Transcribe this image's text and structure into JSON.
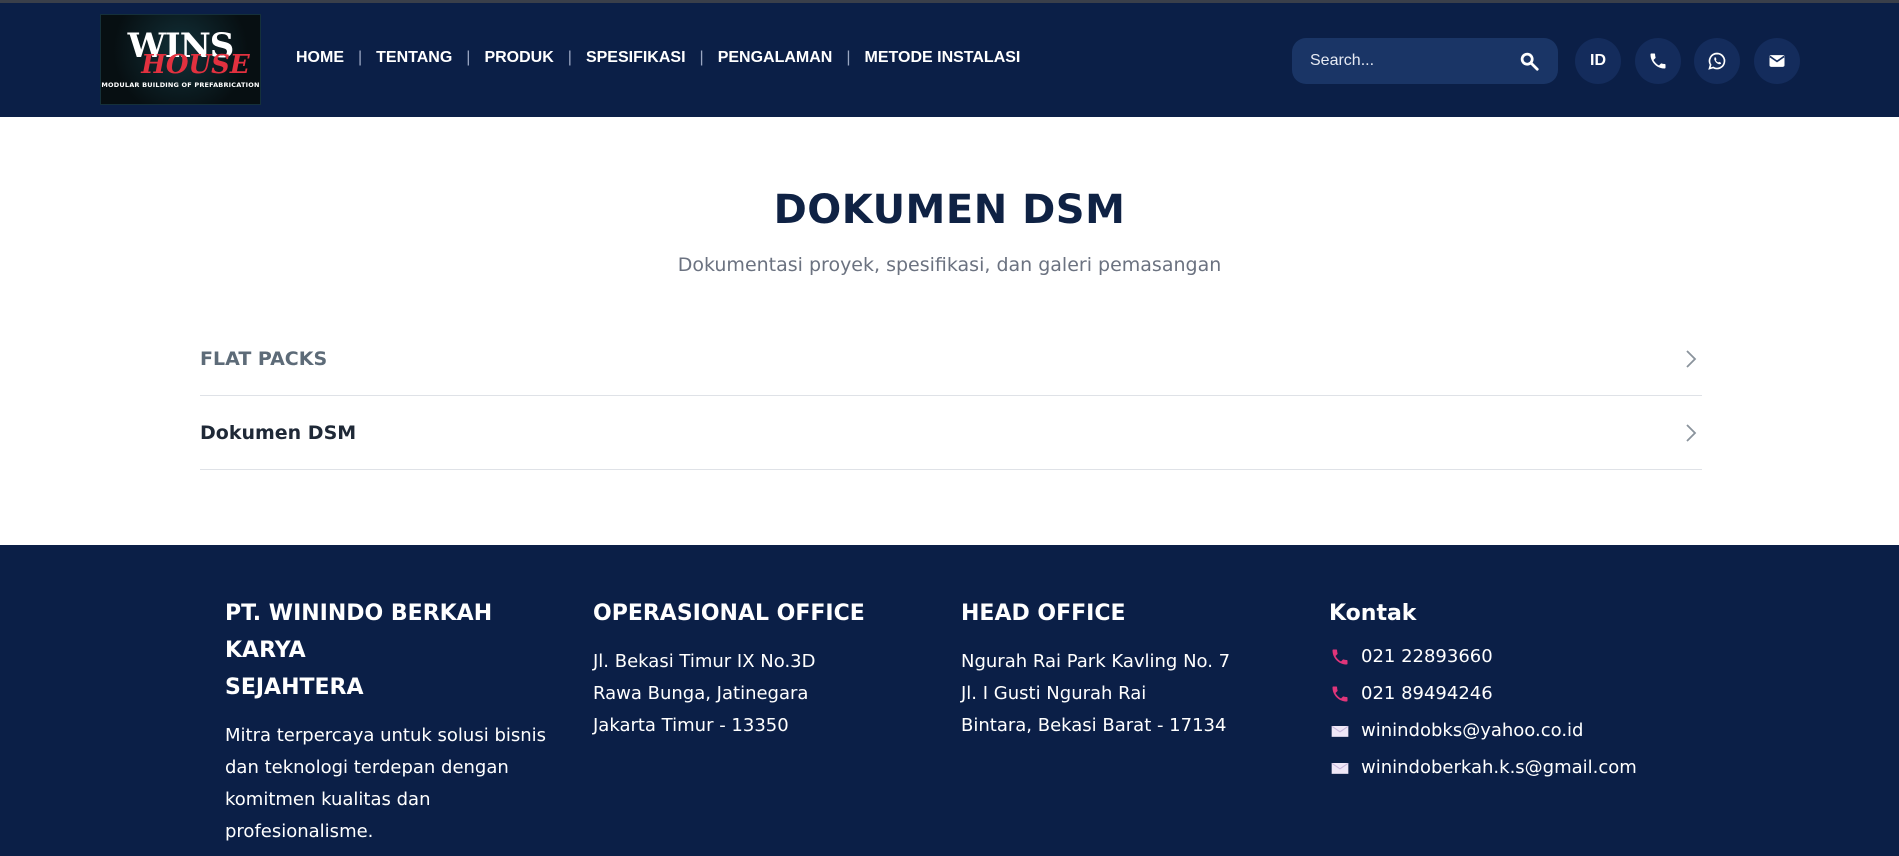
{
  "logo": {
    "word": "WINS",
    "sub": "HOUSE",
    "tagline": "MODULAR BUILDING OF PREFABRICATION"
  },
  "nav": {
    "items": [
      "HOME",
      "TENTANG",
      "PRODUK",
      "SPESIFIKASI",
      "PENGALAMAN",
      "METODE INSTALASI"
    ],
    "separator": "|"
  },
  "search": {
    "placeholder": "Search..."
  },
  "header_buttons": {
    "language": "ID"
  },
  "main": {
    "title": "DOKUMEN DSM",
    "subtitle": "Dokumentasi proyek, spesifikasi, dan galeri pemasangan",
    "accordion": [
      {
        "label": "FLAT PACKS"
      },
      {
        "label": "Dokumen DSM"
      }
    ]
  },
  "footer": {
    "company": {
      "title": "PT. WININDO BERKAH KARYA SEJAHTERA",
      "title_lines": [
        "PT. WININDO BERKAH KARYA",
        "SEJAHTERA"
      ],
      "description_lines": [
        "Mitra terpercaya untuk solusi bisnis",
        "dan teknologi terdepan dengan",
        "komitmen kualitas dan",
        "profesionalisme."
      ]
    },
    "operational": {
      "title": "OPERASIONAL OFFICE",
      "address_lines": [
        "Jl. Bekasi Timur IX No.3D",
        "Rawa Bunga, Jatinegara",
        "Jakarta Timur - 13350"
      ]
    },
    "head": {
      "title": "HEAD OFFICE",
      "address_lines": [
        "Ngurah Rai Park Kavling No. 7",
        "Jl. I Gusti Ngurah Rai",
        "Bintara, Bekasi Barat - 17134"
      ]
    },
    "contact": {
      "title": "Kontak",
      "phones": [
        "021 22893660",
        "021 89494246"
      ],
      "emails": [
        "winindobks@yahoo.co.id",
        "winindoberkah.k.s@gmail.com"
      ]
    }
  },
  "colors": {
    "navy": "#0b1f47",
    "phone_icon": "#e0357a",
    "search_bg": "#1a3566"
  }
}
